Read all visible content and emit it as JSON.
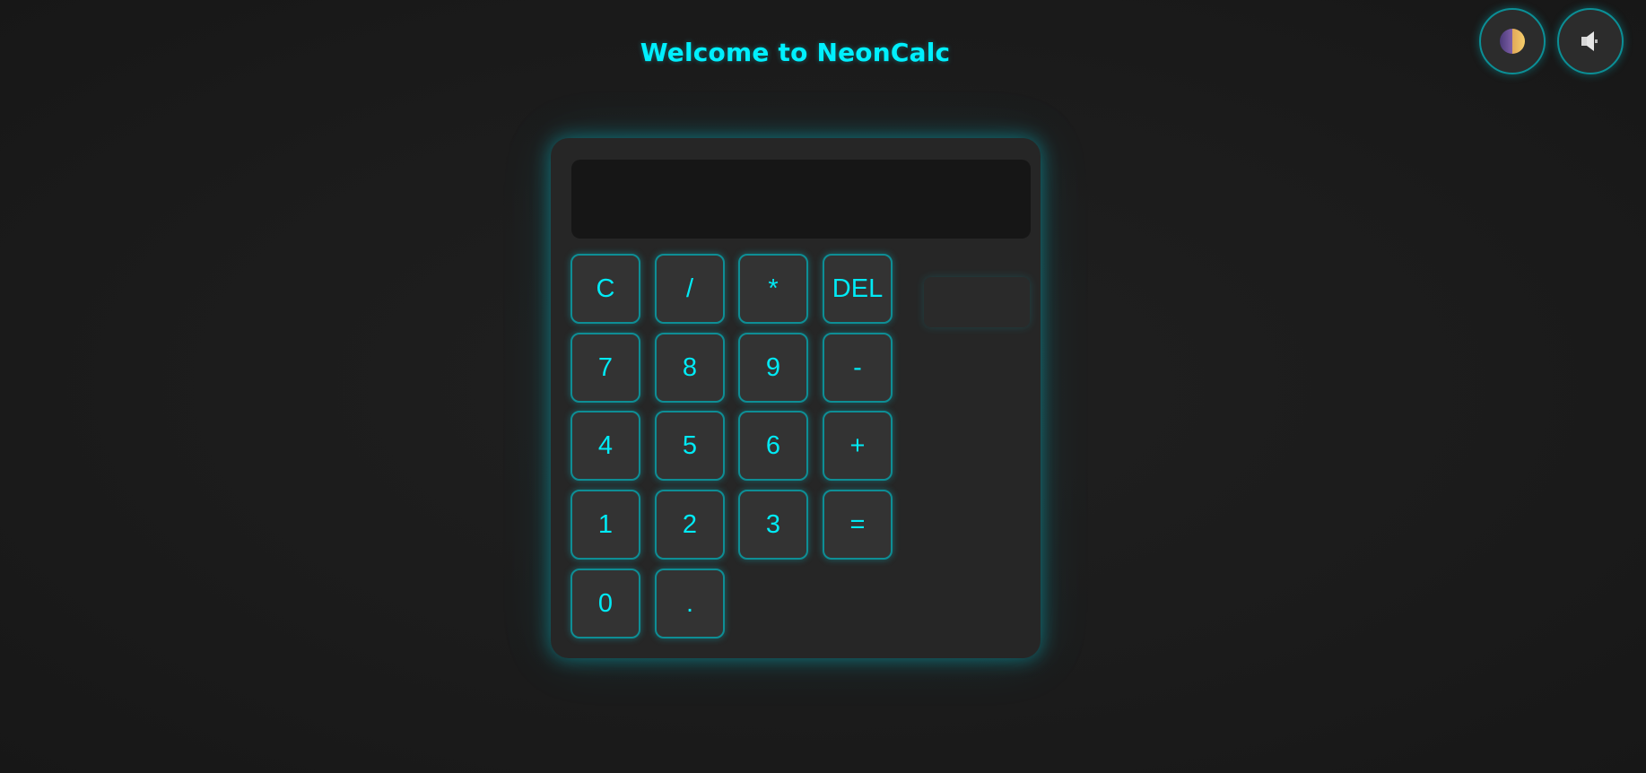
{
  "header": {
    "title": "Welcome to NeonCalc"
  },
  "controls": {
    "theme_icon": "half-moon-icon",
    "sound_icon": "speaker-icon"
  },
  "display": {
    "value": ""
  },
  "keys": {
    "row1": [
      "C",
      "/",
      "*",
      "DEL"
    ],
    "row2": [
      "7",
      "8",
      "9",
      "-"
    ],
    "row3": [
      "4",
      "5",
      "6",
      "+"
    ],
    "row4": [
      "1",
      "2",
      "3",
      "="
    ],
    "row5": [
      "0",
      "."
    ]
  },
  "colors": {
    "accent": "#00f0ff",
    "background": "#1b1b1b",
    "panel": "#262626",
    "key": "#333333"
  }
}
